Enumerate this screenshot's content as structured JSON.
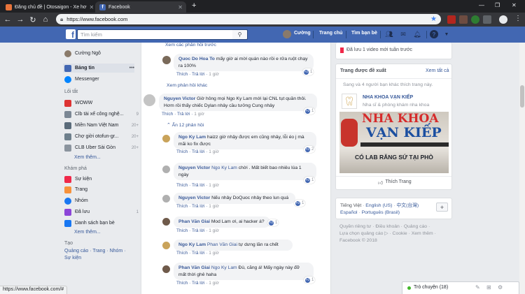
{
  "browser": {
    "tabs": [
      {
        "label": "Đăng chủ đề | Otosaigon - Xe hơ",
        "active": false
      },
      {
        "label": "Facebook",
        "active": true
      }
    ],
    "new_tab": "+",
    "url": "https://www.facebook.com"
  },
  "header": {
    "logo": "f",
    "search_placeholder": "Tìm kiếm",
    "user": "Cường",
    "home": "Trang chủ",
    "find_friends": "Tìm bạn bè"
  },
  "sidebar": {
    "profile": "Cường Ngô",
    "items": [
      {
        "label": "Bảng tin",
        "icon": "news-feed-icon",
        "more": "•••"
      },
      {
        "label": "Messenger",
        "icon": "messenger-icon"
      }
    ],
    "shortcuts_title": "Lối tắt",
    "shortcuts": [
      {
        "label": "WOWW",
        "count": ""
      },
      {
        "label": "Clb tài xế công nghệ...",
        "count": "9"
      },
      {
        "label": "Miền Nam Việt Nam",
        "count": "20+"
      },
      {
        "label": "Chợ giời otofun-gr...",
        "count": "20+"
      },
      {
        "label": "CLB Uber Sài Gòn",
        "count": "20+"
      }
    ],
    "shortcuts_more": "Xem thêm...",
    "explore_title": "Khám phá",
    "explore": [
      {
        "label": "Sự kiện",
        "count": ""
      },
      {
        "label": "Trang",
        "count": ""
      },
      {
        "label": "Nhóm",
        "count": ""
      },
      {
        "label": "Đã lưu",
        "count": "1"
      },
      {
        "label": "Danh sách bạn bè",
        "count": ""
      }
    ],
    "explore_more": "Xem thêm...",
    "create_title": "Tạo",
    "create_links": "Quảng cáo · Trang · Nhóm ·",
    "create_links2": "Sự kiện"
  },
  "feed": {
    "prev_replies_top": "Xem các phản hồi trước",
    "comments_top": [
      {
        "name": "Quoc Do Hoa To",
        "text": "mấy giờ ai mời quán nào rồi e rửa ruột chạy ra 100%",
        "like": "Thích",
        "reply": "Trả lời",
        "time": "1 giờ",
        "reacts": "1"
      }
    ],
    "more_replies": "Xem phản hồi khác",
    "main_comment": {
      "name": "Nguyen Victor",
      "text": "Giờ hông mọi Ngo Ky Lam mới lại CNL tụt quần thôi. Hơm rồi thấy chiếc Dylan nhảy cầu tưởng Cung nhảy",
      "like": "Thích",
      "reply": "Trả lời",
      "time": "1 giờ",
      "reacts": "1"
    },
    "hide_replies": "Ẩn 12 phản hồi",
    "replies": [
      {
        "name": "Ngo Ky Lam",
        "text": "haizz giờ nhậy được em cũng nhảy, lỗi éo j mà mãi ko fix được",
        "like": "Thích",
        "reply": "Trả lời",
        "time": "1 giờ",
        "reacts": "2"
      },
      {
        "name": "Nguyen Victor",
        "tag": "Ngo Ky Lam",
        "text": "chời . Mất biết bao nhiêu lúa 1 ngày",
        "like": "Thích",
        "reply": "Trả lời",
        "time": "1 giờ",
        "reacts": "1"
      },
      {
        "name": "Nguyen Victor",
        "text": "Nếu nhảy DoQuoc nhảy theo lun quá",
        "like": "Thích",
        "reply": "Trả lời",
        "time": "1 giờ",
        "reacts": "1"
      },
      {
        "name": "Phan Văn Giai",
        "text": "Mod Lam ơi, ai hacker á?",
        "like": "Thích",
        "reply": "Trả lời",
        "time": "1 giờ",
        "reacts": "1"
      },
      {
        "name": "Ngo Ky Lam",
        "tag": "Phan Văn Giai",
        "text": "tự dưng lăn ra chết",
        "like": "Thích",
        "reply": "Trả lời",
        "time": "1 giờ",
        "reacts": ""
      },
      {
        "name": "Phan Văn Giai",
        "tag": "Ngo Ky Lam",
        "text": "Đù, căng á! Mấy ngày này đỡ mất thời ghê haha",
        "like": "Thích",
        "reply": "Trả lời",
        "time": "1 giờ",
        "reacts": "1"
      }
    ]
  },
  "right": {
    "saved": "Đã lưu 1 video mới tuần trước",
    "suggested_title": "Trang được đề xuất",
    "see_all": "Xem tất cả",
    "friends_like": "Sang và 4 người bạn khác thích trang này.",
    "page_name": "NHA KHOA VẠN KIẾP",
    "page_type": "Nha sĩ & phòng khám nha khoa",
    "ad_line1": "NHA KHOA",
    "ad_line2": "VẠN KIẾP",
    "ad_line3": "CÓ LAB RĂNG SỨ TẠI PHÒ",
    "like_page": "Thích Trang",
    "languages": [
      "Tiếng Việt",
      "English (US)",
      "中文(台灣)",
      "Español",
      "Português (Brasil)"
    ],
    "add_lang": "+",
    "footer1": "Quyền riêng tư · Điều khoản · Quảng cáo ·",
    "footer2": "Lựa chọn quảng cáo ▷ · Cookie · Xem thêm ·",
    "footer3": "Facebook © 2018"
  },
  "chat": {
    "label": "Trò chuyện (18)"
  },
  "status": {
    "url": "https://www.facebook.com/#"
  }
}
